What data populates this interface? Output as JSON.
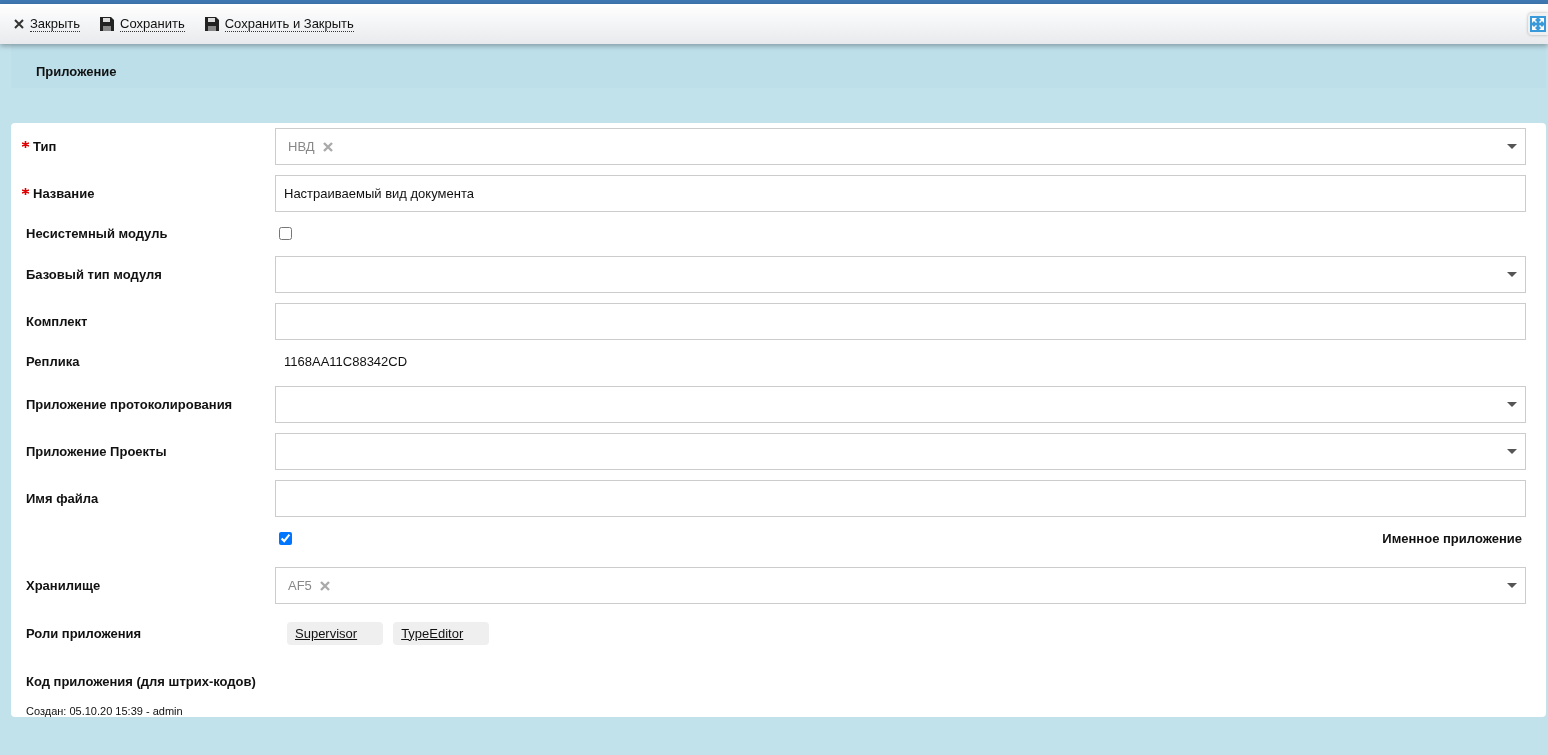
{
  "toolbar": [
    {
      "kind": "close",
      "label": "Закрыть"
    },
    {
      "kind": "save",
      "label": "Сохранить"
    },
    {
      "kind": "save",
      "label": "Сохранить и Закрыть"
    }
  ],
  "tabs": [
    {
      "label": "Приложение",
      "selected": true
    }
  ],
  "fields": [
    {
      "kind": "select",
      "label": "Тип",
      "required": true,
      "tag": "НВД"
    },
    {
      "kind": "text",
      "label": "Название",
      "required": true,
      "value": "Настраиваемый вид документа"
    },
    {
      "kind": "checkbox",
      "label": "Несистемный модуль",
      "required": false,
      "checked": false
    },
    {
      "kind": "select",
      "label": "Базовый тип модуля",
      "required": false
    },
    {
      "kind": "text",
      "label": "Комплект",
      "required": false
    },
    {
      "kind": "readonly",
      "label": "Реплика",
      "required": false,
      "value": "1168AA11C88342CD"
    },
    {
      "kind": "select",
      "label": "Приложение протоколирования",
      "required": false
    },
    {
      "kind": "select",
      "label": "Приложение Проекты",
      "required": false
    },
    {
      "kind": "text",
      "label": "Имя файла",
      "required": false
    },
    {
      "kind": "checkbox_right",
      "side_label": "Именное приложение",
      "required": false,
      "checked": true
    },
    {
      "kind": "select",
      "label": "Хранилище",
      "required": false,
      "tag": "AF5"
    },
    {
      "kind": "roles",
      "label": "Роли приложения",
      "required": false,
      "roles": [
        "Supervisor",
        "TypeEditor"
      ]
    },
    {
      "kind": "empty",
      "label": "Код приложения (для штрих-кодов)",
      "required": false
    }
  ],
  "footer": {
    "created": "Создан: 05.10.20 15:39 -  admin"
  }
}
